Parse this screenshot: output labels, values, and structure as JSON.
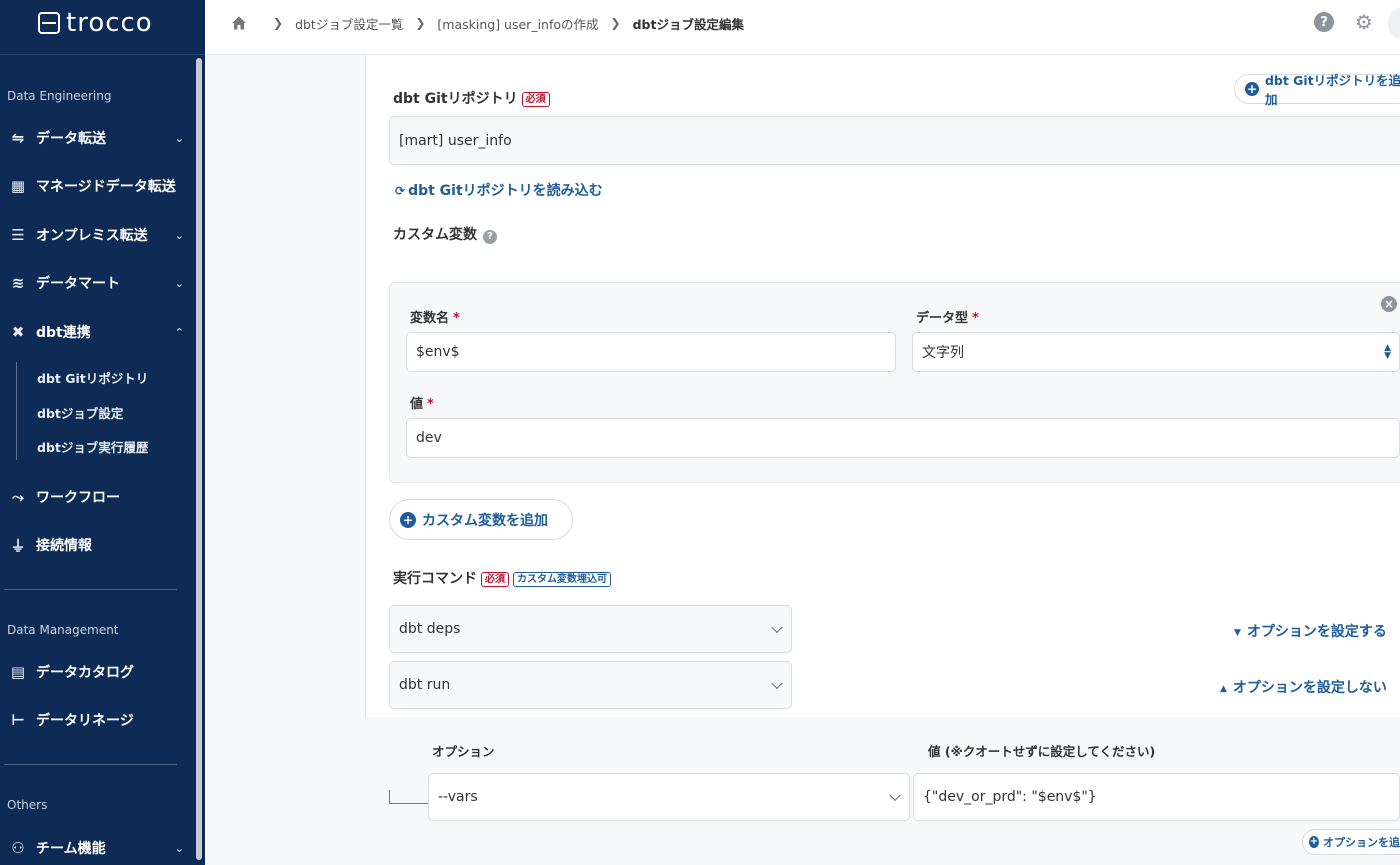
{
  "app": {
    "logo_text": "trocco"
  },
  "sidebar": {
    "sections": [
      {
        "label": "Data Engineering"
      },
      {
        "label": "Data Management"
      },
      {
        "label": "Others"
      }
    ],
    "items": [
      {
        "label": "データ転送",
        "icon": "transfer-icon"
      },
      {
        "label": "マネージドデータ転送",
        "icon": "grid-icon"
      },
      {
        "label": "オンプレミス転送",
        "icon": "server-icon"
      },
      {
        "label": "データマート",
        "icon": "database-icon"
      },
      {
        "label": "dbt連携",
        "icon": "dbt-icon"
      },
      {
        "label": "ワークフロー",
        "icon": "workflow-icon"
      },
      {
        "label": "接続情報",
        "icon": "plug-icon"
      },
      {
        "label": "データカタログ",
        "icon": "catalog-icon"
      },
      {
        "label": "データリネージ",
        "icon": "lineage-icon"
      },
      {
        "label": "チーム機能",
        "icon": "team-icon"
      }
    ],
    "dbt_sub_items": [
      {
        "label": "dbt Gitリポジトリ"
      },
      {
        "label": "dbtジョブ設定"
      },
      {
        "label": "dbtジョブ実行履歴"
      }
    ]
  },
  "breadcrumb": {
    "items": [
      "dbtジョブ設定一覧",
      "[masking] user_infoの作成"
    ],
    "current": "dbtジョブ設定編集"
  },
  "header": {
    "help_icon_glyph": "?",
    "settings_icon_glyph": "⚙"
  },
  "form": {
    "repo": {
      "label": "dbt Gitリポジトリ",
      "required_badge": "必須",
      "add_button": "dbt Gitリポジトリを追加",
      "value": "[mart] user_info",
      "reload_link": "dbt Gitリポジトリを読み込む"
    },
    "custom_vars": {
      "label": "カスタム変数",
      "help_glyph": "?",
      "var_name_label": "変数名",
      "var_name_value": "$env$",
      "data_type_label": "データ型",
      "data_type_value": "文字列",
      "value_label": "値",
      "value_value": "dev",
      "required_mark": "*",
      "add_button": "カスタム変数を追加"
    },
    "commands": {
      "label": "実行コマンド",
      "required_badge": "必須",
      "embed_badge": "カスタム変数埋込可",
      "rows": [
        {
          "value": "dbt deps",
          "option_toggle": "オプションを設定する"
        },
        {
          "value": "dbt run",
          "option_toggle": "オプションを設定しない"
        }
      ],
      "options": {
        "option_header": "オプション",
        "value_header": "値 (※クオートせずに設定してください)",
        "option_value": "--vars",
        "value_value": "{\"dev_or_prd\": \"$env$\"}",
        "add_option": "オプションを追加"
      }
    }
  }
}
